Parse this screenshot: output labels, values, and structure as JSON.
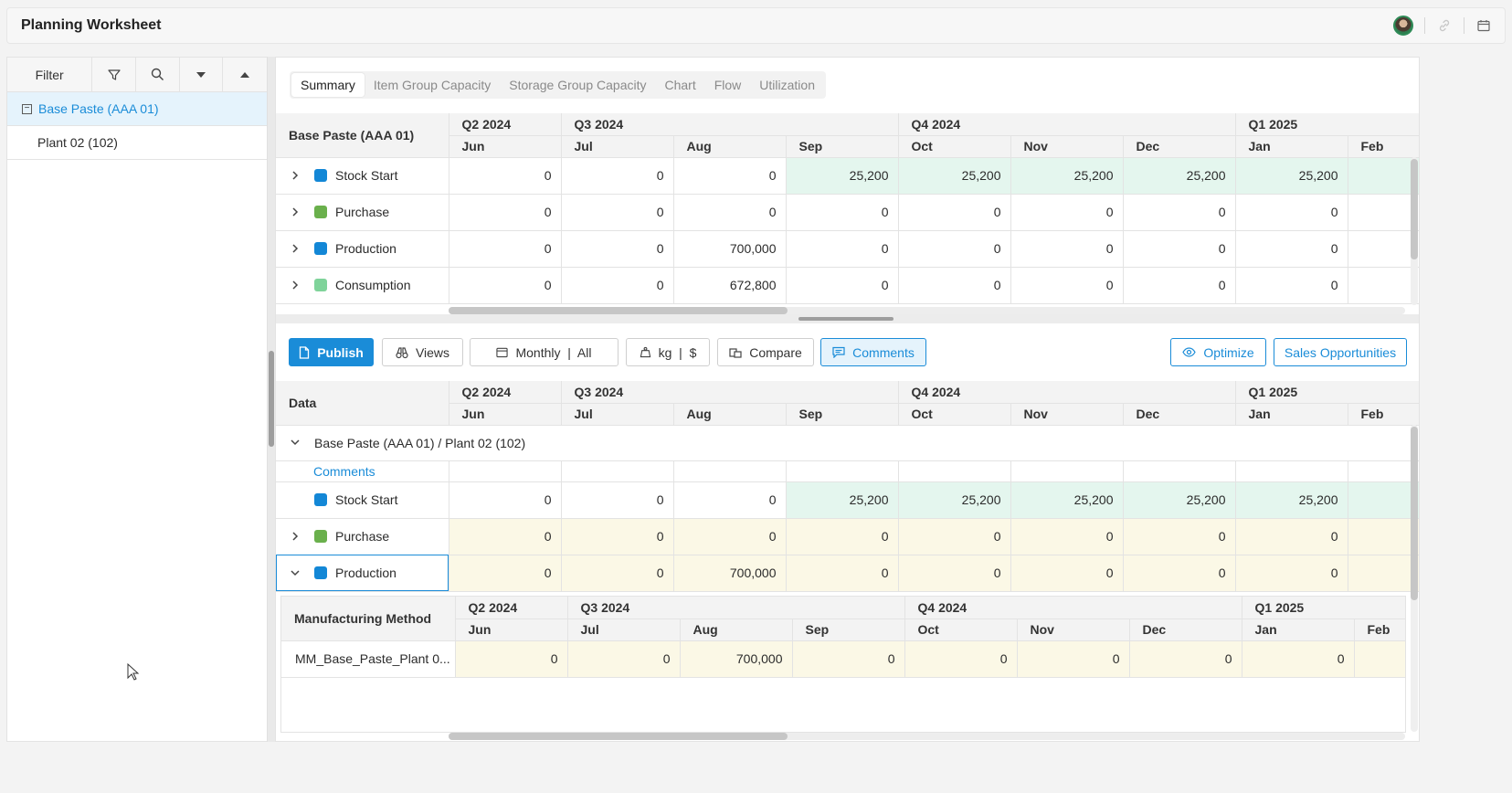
{
  "header": {
    "title": "Planning Worksheet"
  },
  "filter": {
    "label": "Filter"
  },
  "tree": [
    {
      "label": "Base Paste (AAA 01)"
    },
    {
      "label": "Plant 02 (102)"
    }
  ],
  "tabs": [
    "Summary",
    "Item Group Capacity",
    "Storage Group Capacity",
    "Chart",
    "Flow",
    "Utilization"
  ],
  "quarters": [
    "Q2 2024",
    "Q3 2024",
    "Q4 2024",
    "Q1 2025"
  ],
  "months": [
    "Jun",
    "Jul",
    "Aug",
    "Sep",
    "Oct",
    "Nov",
    "Dec",
    "Jan",
    "Feb"
  ],
  "summary": {
    "corner": "Base Paste (AAA 01)",
    "rows": [
      {
        "label": "Stock Start",
        "color": "#1387d6",
        "values": [
          "0",
          "0",
          "0",
          "25,200",
          "25,200",
          "25,200",
          "25,200",
          "25,200",
          ""
        ]
      },
      {
        "label": "Purchase",
        "color": "#6ab04c",
        "values": [
          "0",
          "0",
          "0",
          "0",
          "0",
          "0",
          "0",
          "0",
          ""
        ]
      },
      {
        "label": "Production",
        "color": "#1387d6",
        "values": [
          "0",
          "0",
          "700,000",
          "0",
          "0",
          "0",
          "0",
          "0",
          ""
        ]
      },
      {
        "label": "Consumption",
        "color": "#7fd39a",
        "values": [
          "0",
          "0",
          "672,800",
          "0",
          "0",
          "0",
          "0",
          "0",
          ""
        ]
      }
    ]
  },
  "toolbar": {
    "publish": "Publish",
    "views": "Views",
    "period": "Monthly  |  All",
    "units": "kg  |  $",
    "compare": "Compare",
    "comments": "Comments",
    "optimize": "Optimize",
    "sales": "Sales Opportunities"
  },
  "data": {
    "corner": "Data",
    "group": "Base Paste (AAA 01) / Plant 02 (102)",
    "comments_label": "Comments",
    "rows": [
      {
        "label": "Stock Start",
        "color": "#1387d6",
        "values": [
          "0",
          "0",
          "0",
          "25,200",
          "25,200",
          "25,200",
          "25,200",
          "25,200",
          ""
        ]
      },
      {
        "label": "Purchase",
        "color": "#6ab04c",
        "values": [
          "0",
          "0",
          "0",
          "0",
          "0",
          "0",
          "0",
          "0",
          ""
        ]
      },
      {
        "label": "Production",
        "color": "#1387d6",
        "values": [
          "0",
          "0",
          "700,000",
          "0",
          "0",
          "0",
          "0",
          "0",
          ""
        ]
      }
    ]
  },
  "manufacturing": {
    "corner": "Manufacturing Method",
    "row": {
      "label": "MM_Base_Paste_Plant 0...",
      "values": [
        "0",
        "0",
        "700,000",
        "0",
        "0",
        "0",
        "0",
        "0",
        ""
      ]
    }
  },
  "colors": {
    "accent": "#1a8cd8",
    "stock_bg": "#e4f6ee",
    "editable_bg": "#fbf8e6"
  }
}
